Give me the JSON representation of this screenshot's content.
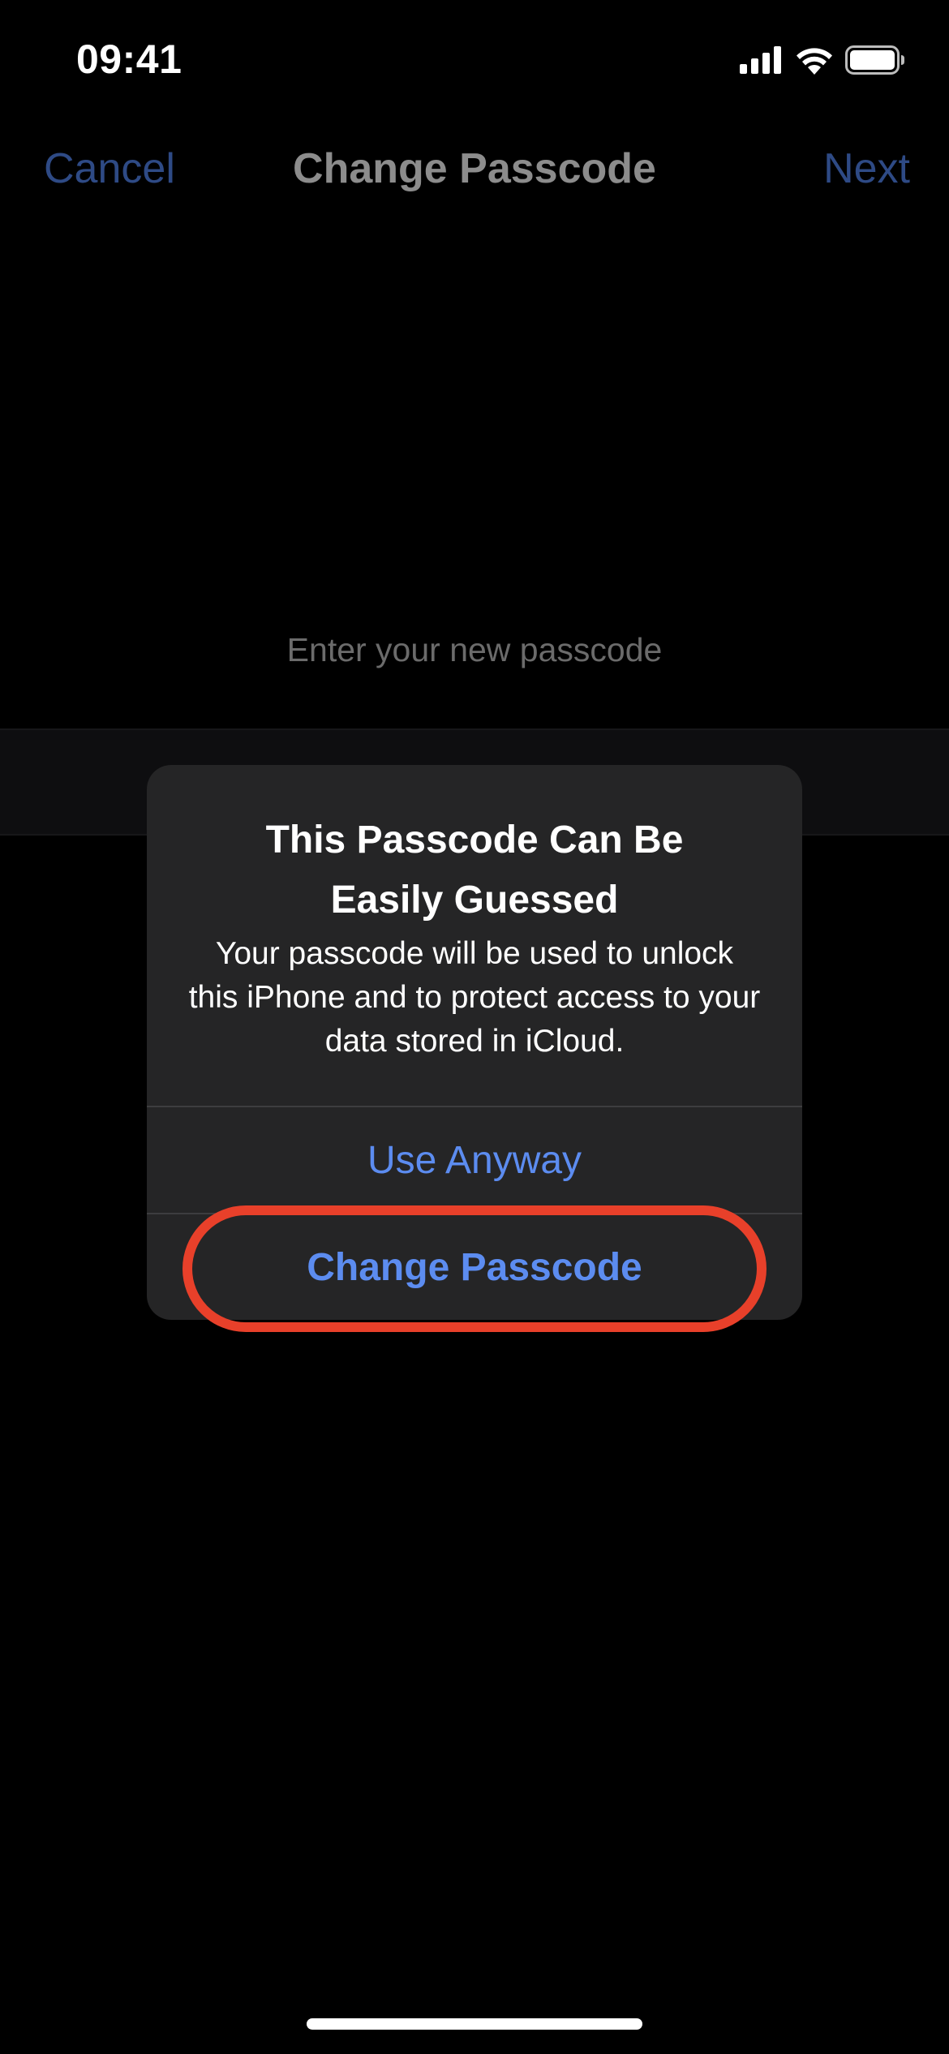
{
  "status_bar": {
    "time": "09:41",
    "icons": [
      "cellular-signal-icon",
      "wifi-icon",
      "battery-icon"
    ]
  },
  "nav": {
    "cancel_label": "Cancel",
    "title": "Change Passcode",
    "next_label": "Next"
  },
  "prompt": {
    "text": "Enter your new passcode"
  },
  "alert": {
    "title": "This Passcode Can Be Easily Guessed",
    "message": "Your passcode will be used to unlock this iPhone and to protect access to your data stored in iCloud.",
    "actions": [
      {
        "label": "Use Anyway"
      },
      {
        "label": "Change Passcode"
      }
    ]
  },
  "colors": {
    "background": "#000000",
    "alert_background": "#252526",
    "action_blue": "#5c8cf0",
    "highlight_red": "#e8402a"
  }
}
